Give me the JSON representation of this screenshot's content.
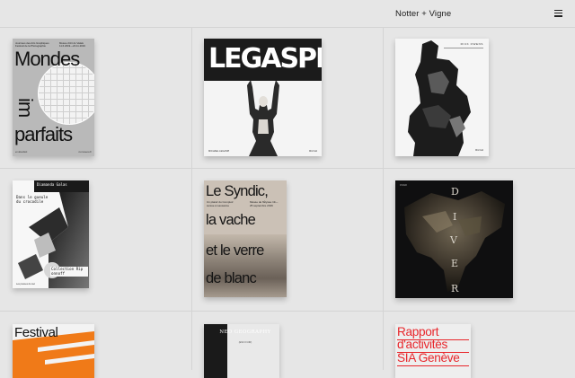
{
  "header": {
    "brand": "Notter + Vigne",
    "menu_icon": "hamburger-menu-icon"
  },
  "projects": [
    {
      "id": "mondes-imparfaits",
      "header_left": "Journées des Arts Graphiques Festival de la Photographie",
      "header_right": "Musée d'Art du Valais 11.6.2019—24.11.2019",
      "line1": "Mondes",
      "line2": "im",
      "line3": "parfaits",
      "footer_left": "en attendant",
      "footer_right": "vs-musees.ch"
    },
    {
      "id": "legaspi",
      "logo": "LEGASPI",
      "footer_left": "MICHAEL LEGASPI",
      "publisher": "Rizzoli"
    },
    {
      "id": "rick-owens",
      "name": "RICK OWENS",
      "publisher": "Rizzoli"
    },
    {
      "id": "diamanda-galas",
      "artist": "Diamanda Galas",
      "title": "Dans le gueule du crocodile",
      "collection": "Collection Rip onnoff",
      "footer": "Les presses du réel"
    },
    {
      "id": "le-syndic",
      "line1": "Le Syndic,",
      "line2": "la vache",
      "line3": "et le verre",
      "line4": "de blanc",
      "info_left": "Un plaisir du Comptoir suisse à Lausanne",
      "info_right": "Musée de l'Élysée 19—25 septembre 2016"
    },
    {
      "id": "diver",
      "header": "DIVER",
      "letters": [
        "D",
        "I",
        "V",
        "E",
        "R"
      ]
    },
    {
      "id": "festival",
      "title": "Festival"
    },
    {
      "id": "neo-geography",
      "title": "NEO GEOGRAPHY",
      "subtitle": "(ESCI FUIR)"
    },
    {
      "id": "rapport",
      "line1": "Rapport",
      "line2": "d'activités",
      "line3": "SIA Genève"
    }
  ]
}
